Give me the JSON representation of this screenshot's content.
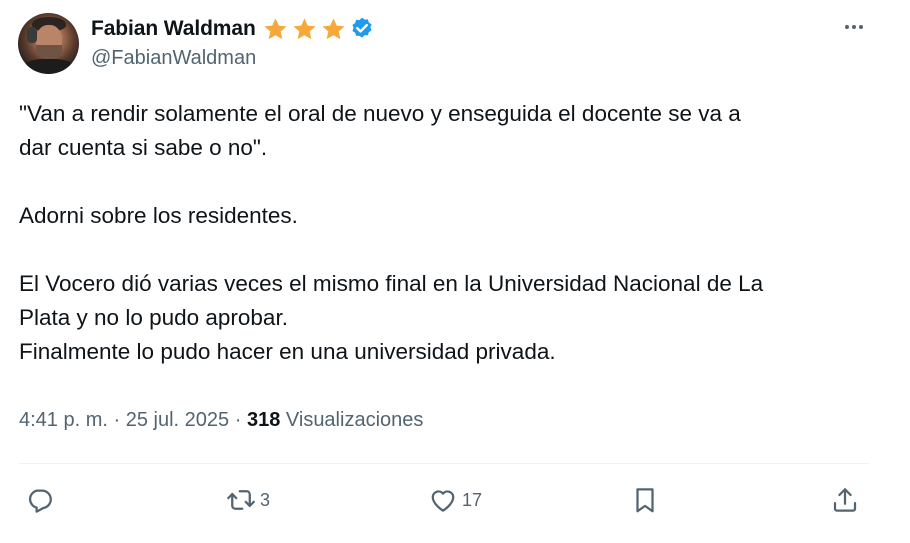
{
  "author": {
    "display_name": "Fabian Waldman",
    "handle": "@FabianWaldman",
    "badge_icons": [
      "star-icon",
      "star-icon",
      "star-icon",
      "verified-badge-icon"
    ]
  },
  "tweet": {
    "lines": [
      "\"Van a rendir solamente el oral de nuevo y enseguida el docente se va a",
      "dar cuenta si sabe o no\".",
      "Adorni sobre los residentes.",
      "El Vocero dió varias veces el mismo final en la Universidad Nacional de La",
      "Plata y no lo pudo aprobar.",
      "Finalmente lo pudo hacer en una universidad privada."
    ],
    "time": "4:41 p. m.",
    "date": "25 jul. 2025",
    "separator": "·",
    "views_count": "318",
    "views_label": "Visualizaciones"
  },
  "actions": {
    "reply_count": "",
    "retweet_count": "3",
    "like_count": "17"
  },
  "colors": {
    "text": "#0f1419",
    "secondary": "#536471",
    "verified": "#1d9bf0",
    "star": "#f4a93a",
    "divider": "#eff3f4"
  }
}
